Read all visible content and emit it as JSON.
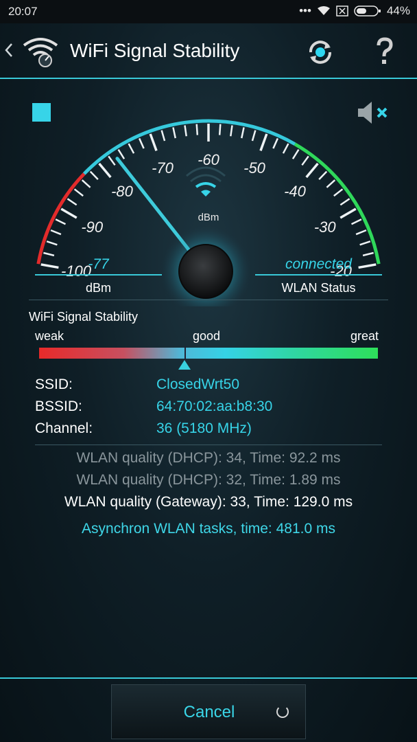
{
  "status_bar": {
    "time": "20:07",
    "battery": "44%"
  },
  "app_bar": {
    "title": "WiFi Signal Stability"
  },
  "gauge": {
    "unit": "dBm",
    "ticks": [
      "-100",
      "-90",
      "-80",
      "-70",
      "-60",
      "-50",
      "-40",
      "-30",
      "-20"
    ],
    "needle_value": -77
  },
  "readouts": {
    "left": {
      "value": "-77",
      "label": "dBm"
    },
    "right": {
      "value": "connected",
      "label": "WLAN Status"
    }
  },
  "stability": {
    "title": "WiFi Signal Stability",
    "weak": "weak",
    "good": "good",
    "great": "great",
    "level_fraction": 0.43
  },
  "info": [
    {
      "key": "SSID:",
      "value": "ClosedWrt50"
    },
    {
      "key": "BSSID:",
      "value": "64:70:02:aa:b8:30"
    },
    {
      "key": "Channel:",
      "value": "36 (5180 MHz)"
    }
  ],
  "quality": [
    "WLAN quality (DHCP): 34, Time: 92.2 ms",
    "WLAN quality (DHCP): 32, Time: 1.89 ms",
    "WLAN quality (Gateway): 33, Time: 129.0 ms",
    "Asynchron WLAN tasks, time: 481.0 ms"
  ],
  "cancel_button": {
    "label": "Cancel"
  },
  "colors": {
    "accent": "#37d4e8",
    "weak": "#e82a2a",
    "great": "#2ee05a"
  },
  "icons": [
    "back-icon",
    "wifi-speedometer-icon",
    "refresh-icon",
    "help-icon",
    "stop-icon",
    "speaker-muted-icon"
  ]
}
